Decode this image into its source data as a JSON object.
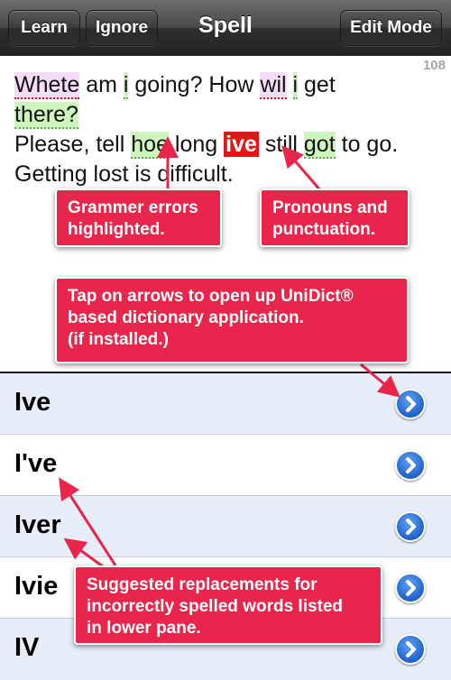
{
  "navbar": {
    "learn_label": "Learn",
    "ignore_label": "Ignore",
    "title": "Spell",
    "edit_mode_label": "Edit Mode"
  },
  "editor": {
    "counter": "108",
    "line1_a": "Whete",
    "line1_b": " am ",
    "line1_c": "i",
    "line1_d": " going? How ",
    "line1_e": "wil",
    "line1_f": " ",
    "line1_g": "i",
    "line1_h": " get ",
    "line2_a": "there?",
    "line3_a": "Please, tell ",
    "line3_b": "hoe",
    "line3_c": " long ",
    "line3_d": "ive",
    "line3_e": " still ",
    "line3_f": "got",
    "line3_g": " to go. Getting lost is difficult."
  },
  "suggestions": [
    {
      "word": "Ive"
    },
    {
      "word": "I've"
    },
    {
      "word": "Iver"
    },
    {
      "word": "Ivie"
    },
    {
      "word": "IV"
    }
  ],
  "callouts": {
    "grammar": "Grammer errors\nhighlighted.",
    "pronouns": "Pronouns and\npunctuation.",
    "dictionary": "Tap on arrows to open up UniDict®\nbased dictionary application.\n(if installed.)",
    "suggested": "Suggested replacements for\nincorrectly spelled words listed\nin lower pane."
  },
  "icons": {
    "disclosure": "chevron-right-circle-icon"
  },
  "colors": {
    "callout": "#e8254a",
    "spelling_highlight": "#f5dcf7",
    "grammar_highlight": "#cdf5bd",
    "selected_word": "#e01818",
    "disclosure_blue": "#2a6fd6"
  }
}
